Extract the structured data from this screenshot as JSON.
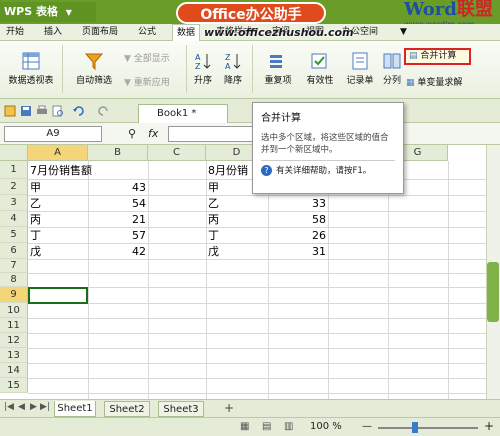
{
  "title_bar": {
    "app_name": "WPS 表格",
    "dropdown_glyph": "▼",
    "banner": "Office办公助手"
  },
  "watermark": {
    "logo_word": "Word",
    "logo_suffix": "联盟",
    "logo_url": "www.wordlm.com",
    "site_url": "www.officezhushou.com"
  },
  "menu": {
    "items": [
      "开始",
      "插入",
      "页面布局",
      "公式",
      "数据",
      "表格样式",
      "审阅",
      "视图",
      "办公空间"
    ],
    "active": "数据",
    "extra": "▼"
  },
  "ribbon": {
    "pivot_table": "数据透视表",
    "auto_filter": "自动筛选",
    "show_all": "全部显示",
    "reapply": "重新应用",
    "sort_asc": "升序",
    "sort_desc": "降序",
    "duplicates": "重复项",
    "validity": "有效性",
    "record": "记录单",
    "columns": "分列",
    "consolidate": "合并计算",
    "solver": "单变量求解"
  },
  "quick_bar": {
    "book_tab": "Book1 *"
  },
  "formula_bar": {
    "name_box": "A9",
    "fx": "fx"
  },
  "columns": [
    "A",
    "B",
    "C",
    "D",
    "E",
    "F",
    "G"
  ],
  "rows": [
    "1",
    "2",
    "3",
    "4",
    "5",
    "6",
    "7",
    "8",
    "9",
    "10",
    "11",
    "12",
    "13",
    "14",
    "15"
  ],
  "selected_col": "A",
  "selected_row": "9",
  "table_left": {
    "header": "7月份销售额",
    "items": [
      "甲",
      "乙",
      "丙",
      "丁",
      "戊"
    ],
    "values": [
      "43",
      "54",
      "21",
      "57",
      "42"
    ]
  },
  "table_right": {
    "header": "8月份销",
    "items": [
      "甲",
      "乙",
      "丙",
      "丁",
      "戊"
    ],
    "values": [
      "",
      "33",
      "58",
      "26",
      "31"
    ]
  },
  "tooltip": {
    "title": "合并计算",
    "desc": "选中多个区域，将这些区域的值合并到一个新区域中。",
    "help": "有关详细帮助，请按F1。"
  },
  "sheets": [
    "Sheet1",
    "Sheet2",
    "Sheet3"
  ],
  "active_sheet": "Sheet1",
  "add_sheet": "+",
  "status": {
    "zoom": "100 %",
    "minus": "—",
    "plus": "+"
  },
  "colors": {
    "accent_green": "#6a9c28",
    "highlight_red": "#dd2222",
    "banner_orange": "#e04a1c"
  }
}
